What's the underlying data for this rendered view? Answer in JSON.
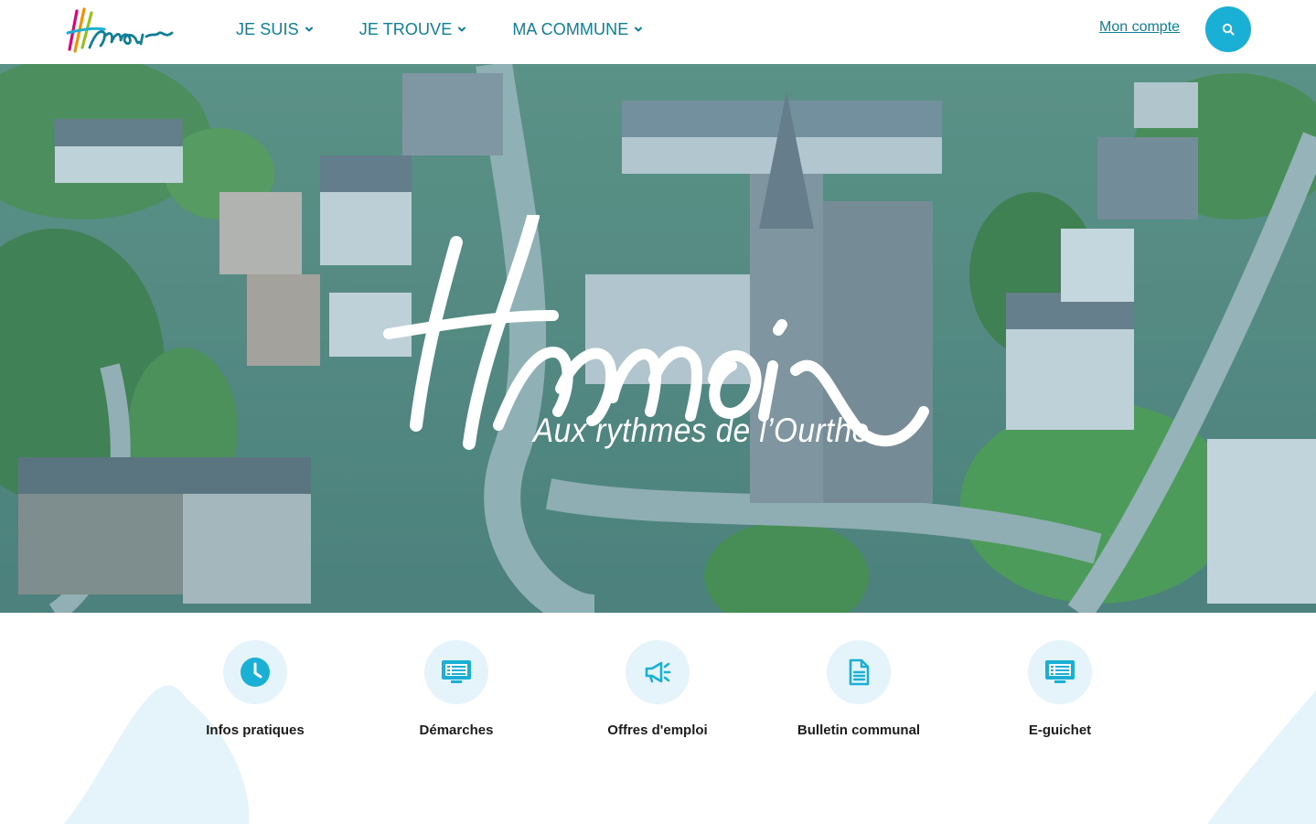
{
  "header": {
    "logo_text": "Hamoir",
    "nav": [
      {
        "label": "JE SUIS"
      },
      {
        "label": "JE TROUVE"
      },
      {
        "label": "MA COMMUNE"
      }
    ],
    "account_label": "Mon compte",
    "search_icon": "search-icon"
  },
  "hero": {
    "logo_text": "Hamoir",
    "tagline": "Aux rythmes de l’Ourthe"
  },
  "quick_links": [
    {
      "label": "Infos pratiques",
      "icon": "clock-icon"
    },
    {
      "label": "Démarches",
      "icon": "monitor-list-icon"
    },
    {
      "label": "Offres d'emploi",
      "icon": "megaphone-icon"
    },
    {
      "label": "Bulletin communal",
      "icon": "document-icon"
    },
    {
      "label": "E-guichet",
      "icon": "monitor-list-icon"
    }
  ],
  "colors": {
    "primary": "#0f7f99",
    "accent": "#1aafd4",
    "icon_bg": "#e4f4fa",
    "deco": "#e4f4fa"
  }
}
